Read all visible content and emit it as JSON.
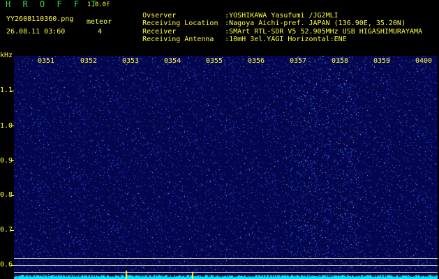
{
  "header": {
    "app_title": "H R O F F T",
    "app_version": "1.0.0f",
    "file_name": "YY2608110360.png",
    "timestamp": "26.08.11 03:60",
    "meteor_label": "meteor",
    "meteor_count": "4"
  },
  "info": [
    {
      "key": "Ovserver",
      "value": ":YOSHIKAWA Yasufumi /JG2MLI"
    },
    {
      "key": "Receiving Location",
      "value": ":Nagoya Aichi-pref. JAPAN (136.90E, 35.20N)"
    },
    {
      "key": "Receiver",
      "value": ":SMArt RTL-SDR V5 52.905MHz USB HIGASHIMURAYAMA"
    },
    {
      "key": "Receiving Antenna",
      "value": ":10mH 3el.YAGI Horizontal:ENE"
    }
  ],
  "axis": {
    "y_unit": "kHz",
    "y_ticks": [
      "1.1",
      "1.0",
      "0.9",
      "0.8",
      "0.7",
      "0.6"
    ],
    "x_ticks": [
      "0351",
      "0352",
      "0353",
      "0354",
      "0355",
      "0356",
      "0357",
      "0358",
      "0359",
      "0400"
    ]
  },
  "colors": {
    "background": "#000000",
    "label": "#ffff40",
    "title": "#3bd93b",
    "spectrogram_bg": "#05064a",
    "noise": "#3a5cff",
    "baseline": "#00e5ff"
  }
}
